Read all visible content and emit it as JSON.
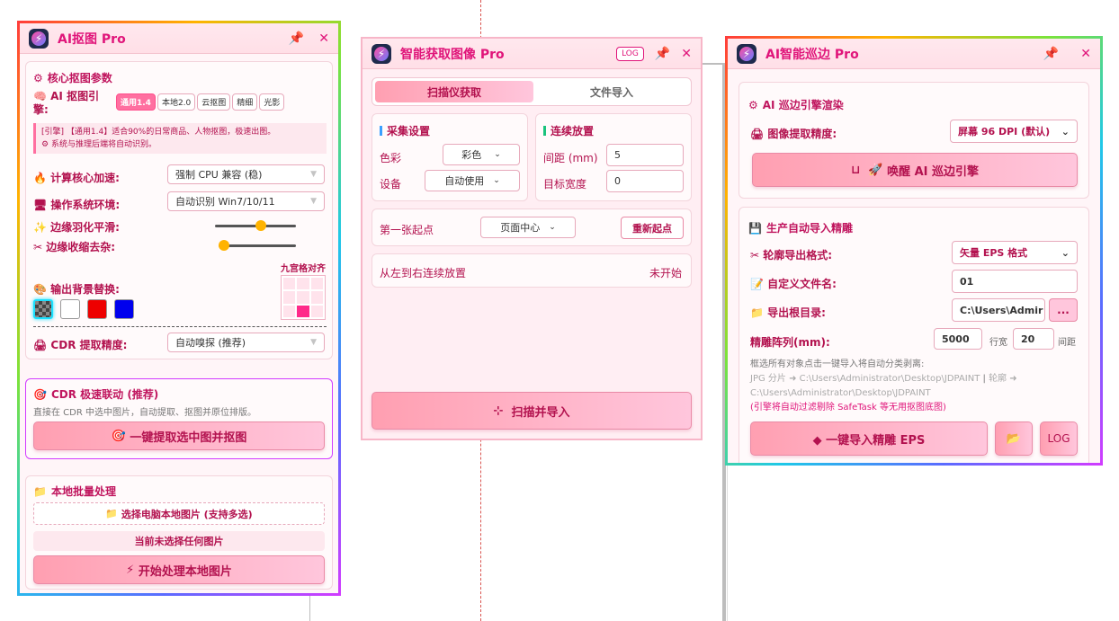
{
  "p1": {
    "title": "AI抠图 Pro",
    "core_title": "核心抠图参数",
    "engine_label": "AI 抠图引擎:",
    "engine_chips": [
      "通用1.4",
      "本地2.0",
      "云抠图",
      "精细",
      "光影"
    ],
    "tip1": "[引擎] 【通用1.4】适合90%的日常商品、人物抠图，极速出图。",
    "tip2": "系统与推理后端将自动识别。",
    "accel_label": "计算核心加速:",
    "accel_value": "强制 CPU 兼容 (稳)",
    "os_label": "操作系统环境:",
    "os_value": "自动识别 Win7/10/11",
    "feather_label": "边缘羽化平滑:",
    "shrink_label": "边缘收缩去杂:",
    "feather_level": 0.58,
    "shrink_level": 0.0,
    "align_label": "九宫格对齐",
    "bg_label": "输出背景替换:",
    "swatch_colors": [
      "#555555",
      "#ffffff",
      "#ee0000",
      "#0000ee"
    ],
    "cdr_label": "CDR 提取精度:",
    "cdr_value": "自动嗅探 (推荐)",
    "link_title": "CDR 极速联动 (推荐)",
    "link_desc": "直接在 CDR 中选中图片，自动提取、抠图并原位排版。",
    "link_btn": "一键提取选中图并抠图",
    "batch_title": "本地批量处理",
    "pick_btn": "选择电脑本地图片 (支持多选)",
    "none_selected": "当前未选择任何图片",
    "start_btn": "开始处理本地图片"
  },
  "p2": {
    "title": "智能获取图像 Pro",
    "log": "LOG",
    "tab_scan": "扫描仪获取",
    "tab_file": "文件导入",
    "collect_title": "采集设置",
    "color_label": "色彩",
    "color_value": "彩色",
    "device_label": "设备",
    "device_value": "自动使用",
    "place_title": "连续放置",
    "gap_label": "间距 (mm)",
    "gap_value": "5",
    "width_label": "目标宽度",
    "width_value": "0",
    "start_label": "第一张起点",
    "start_value": "页面中心",
    "reset_btn": "重新起点",
    "flow_label": "从左到右连续放置",
    "flow_status": "未开始",
    "scan_btn": "扫描并导入"
  },
  "p3": {
    "title": "AI智能巡边 Pro",
    "engine_title": "AI 巡边引擎渲染",
    "precision_label": "图像提取精度:",
    "precision_value": "屏幕 96 DPI (默认)",
    "wake_btn": "唤醒 AI 巡边引擎",
    "import_title": "生产自动导入精雕",
    "format_label": "轮廓导出格式:",
    "format_value": "矢量 EPS 格式",
    "filename_label": "自定义文件名:",
    "filename_value": "01",
    "dir_label": "导出根目录:",
    "dir_value": "C:\\Users\\Admir",
    "dots": "...",
    "array_label": "精雕阵列(mm):",
    "array_w": "5000",
    "row_label": "行宽",
    "array_gap": "20",
    "gap_label": "间距",
    "hint1": "框选所有对象点击一键导入将自动分类剥离:",
    "hint2": "JPG 分片 ➜ C:\\Users\\Administrator\\Desktop\\JDPAINT",
    "hint_sep": "|",
    "hint3": "轮廓 ➜",
    "hint4": "C:\\Users\\Administrator\\Desktop\\JDPAINT",
    "hint5": "(引擎将自动过滤剔除 SafeTask 等无用抠图底图)",
    "import_btn": "◆ 一键导入精雕 EPS",
    "log": "LOG"
  }
}
